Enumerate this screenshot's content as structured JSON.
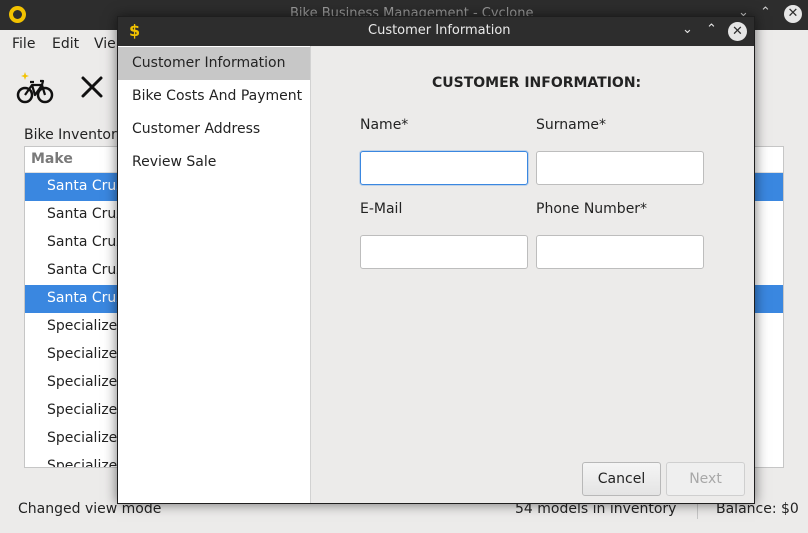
{
  "main_window": {
    "title": "Bike Business Management - Cyclone",
    "menu": [
      "File",
      "Edit",
      "Vie"
    ],
    "toolbar": {
      "new_bike_icon": "bicycle-add-icon",
      "remove_icon": "close-x-icon"
    },
    "inventory_label": "Bike Inventory",
    "table": {
      "column_header": "Make",
      "rows": [
        {
          "make": "Santa Cruz",
          "selected": true
        },
        {
          "make": "Santa Cruz",
          "selected": false
        },
        {
          "make": "Santa Cruz",
          "selected": false
        },
        {
          "make": "Santa Cruz",
          "selected": false
        },
        {
          "make": "Santa Cruz",
          "selected": true
        },
        {
          "make": "Specialized",
          "selected": false
        },
        {
          "make": "Specialized",
          "selected": false
        },
        {
          "make": "Specialized",
          "selected": false
        },
        {
          "make": "Specialized",
          "selected": false
        },
        {
          "make": "Specialized",
          "selected": false
        },
        {
          "make": "Specialized",
          "selected": false
        }
      ]
    },
    "status": {
      "message": "Changed view mode",
      "inventory_count": "54 models in inventory",
      "balance": "Balance: $0"
    }
  },
  "dialog": {
    "title": "Customer Information",
    "icon": "dollar-icon",
    "nav": [
      {
        "label": "Customer Information",
        "active": true
      },
      {
        "label": "Bike Costs And Payment",
        "active": false
      },
      {
        "label": "Customer Address",
        "active": false
      },
      {
        "label": "Review Sale",
        "active": false
      }
    ],
    "heading": "CUSTOMER INFORMATION:",
    "fields": {
      "name": {
        "label": "Name*",
        "value": ""
      },
      "surname": {
        "label": "Surname*",
        "value": ""
      },
      "email": {
        "label": "E-Mail",
        "value": ""
      },
      "phone": {
        "label": "Phone Number*",
        "value": ""
      }
    },
    "buttons": {
      "cancel": "Cancel",
      "next": "Next"
    },
    "colors": {
      "accent": "#3a87e0",
      "titlebar": "#2d2d2d",
      "icon_yellow": "#f2c200"
    }
  }
}
